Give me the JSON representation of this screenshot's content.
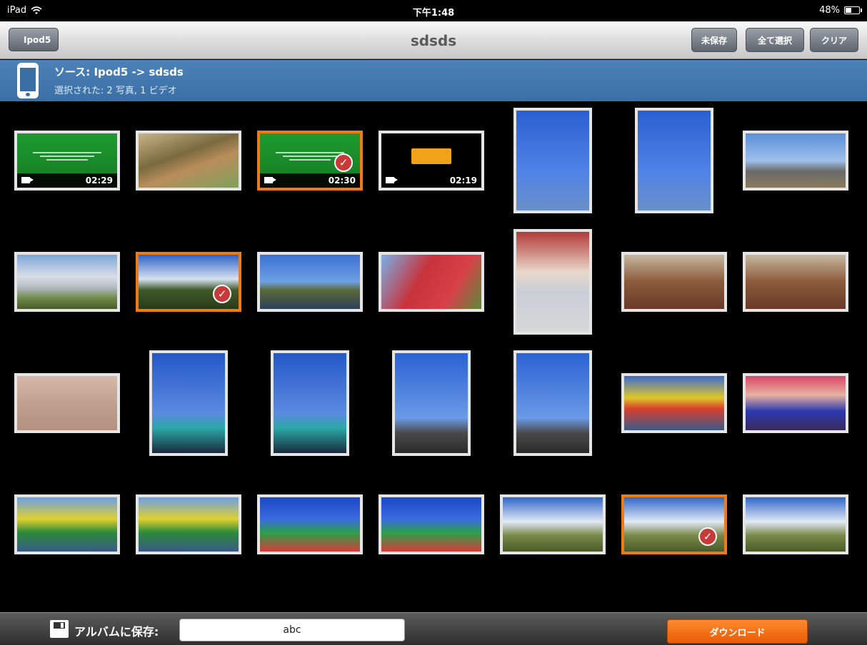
{
  "status_bar": {
    "carrier": "iPad",
    "time": "下午1:48",
    "battery": "48%",
    "battery_level": 0.48
  },
  "nav": {
    "back_label": "Ipod5",
    "title": "sdsds",
    "buttons": [
      "未保存",
      "全て選択",
      "クリア"
    ]
  },
  "info": {
    "source": "ソース: Ipod5 -> sdsds",
    "selection": "選択された: 2 写真, 1 ビデオ"
  },
  "grid": {
    "items": [
      {
        "type": "video",
        "duration": "02:29",
        "selected": false,
        "kind": "green"
      },
      {
        "type": "photo",
        "selected": false,
        "kind": "garden"
      },
      {
        "type": "video",
        "duration": "02:30",
        "selected": true,
        "kind": "green"
      },
      {
        "type": "video",
        "duration": "02:19",
        "selected": false,
        "kind": "dark"
      },
      {
        "type": "photo",
        "selected": false,
        "kind": "tower"
      },
      {
        "type": "photo",
        "selected": false,
        "kind": "tower"
      },
      {
        "type": "photo",
        "selected": false,
        "kind": "ride"
      },
      {
        "type": "photo",
        "selected": false,
        "kind": "cloudsky"
      },
      {
        "type": "photo",
        "selected": true,
        "kind": "trees"
      },
      {
        "type": "photo",
        "selected": false,
        "kind": "lake"
      },
      {
        "type": "photo",
        "selected": false,
        "kind": "building"
      },
      {
        "type": "photo",
        "selected": false,
        "kind": "child"
      },
      {
        "type": "photo",
        "selected": false,
        "kind": "indoor"
      },
      {
        "type": "photo",
        "selected": false,
        "kind": "indoor"
      },
      {
        "type": "photo",
        "selected": false,
        "kind": "ground"
      },
      {
        "type": "photo",
        "selected": false,
        "kind": "crane"
      },
      {
        "type": "photo",
        "selected": false,
        "kind": "crane"
      },
      {
        "type": "photo",
        "selected": false,
        "kind": "arm"
      },
      {
        "type": "photo",
        "selected": false,
        "kind": "arm"
      },
      {
        "type": "photo",
        "selected": false,
        "kind": "kiddie"
      },
      {
        "type": "photo",
        "selected": false,
        "kind": "bumper"
      },
      {
        "type": "photo",
        "selected": false,
        "kind": "swing"
      },
      {
        "type": "photo",
        "selected": false,
        "kind": "swing"
      },
      {
        "type": "photo",
        "selected": false,
        "kind": "spin"
      },
      {
        "type": "photo",
        "selected": false,
        "kind": "spin"
      },
      {
        "type": "photo",
        "selected": false,
        "kind": "field"
      },
      {
        "type": "photo",
        "selected": true,
        "kind": "field"
      },
      {
        "type": "photo",
        "selected": false,
        "kind": "field"
      },
      {
        "type": "photo",
        "selected": false,
        "kind": "partial"
      },
      {
        "type": "photo",
        "selected": false,
        "kind": "partial"
      },
      {
        "type": "photo",
        "selected": false,
        "kind": "partial"
      },
      {
        "type": "photo",
        "selected": false,
        "kind": "partial"
      },
      {
        "type": "photo",
        "selected": false,
        "kind": "leaves"
      },
      {
        "type": "photo",
        "selected": false,
        "kind": "leaves2"
      },
      {
        "type": "photo",
        "selected": false,
        "kind": "partial"
      }
    ]
  },
  "bottom": {
    "save_label": "アルバムに保存:",
    "album_value": "abc",
    "download_label": "ダウンロード"
  }
}
